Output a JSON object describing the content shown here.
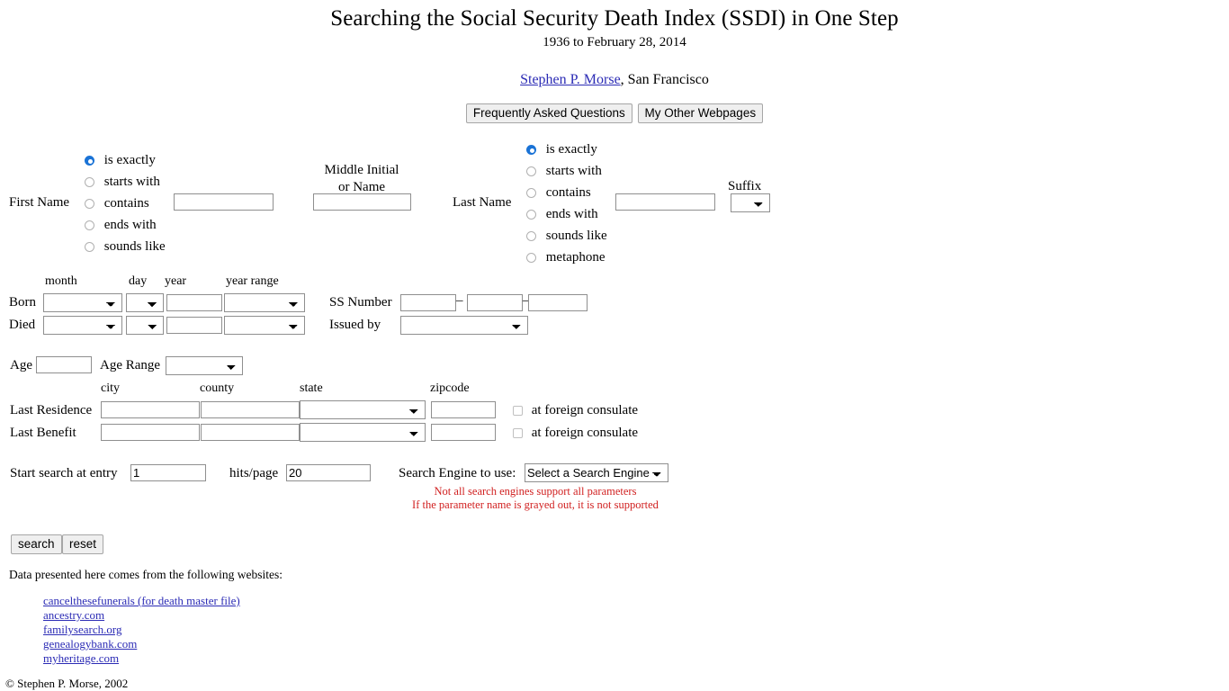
{
  "header": {
    "title": "Searching the Social Security Death Index (SSDI) in One Step",
    "subtitle": "1936 to February 28, 2014",
    "author_link": "Stephen P. Morse",
    "author_suffix": ", San Francisco",
    "faq_button": "Frequently Asked Questions",
    "webpages_button": "My Other Webpages"
  },
  "first_name": {
    "label": "First Name",
    "options": [
      "is exactly",
      "starts with",
      "contains",
      "ends with",
      "sounds like"
    ],
    "selected": "is exactly",
    "value": ""
  },
  "middle_name": {
    "label_line1": "Middle Initial",
    "label_line2": "or Name",
    "value": ""
  },
  "last_name": {
    "label": "Last Name",
    "options": [
      "is exactly",
      "starts with",
      "contains",
      "ends with",
      "sounds like",
      "metaphone"
    ],
    "selected": "is exactly",
    "value": ""
  },
  "suffix": {
    "label": "Suffix",
    "selected": "",
    "options": [
      ""
    ]
  },
  "dates": {
    "col_month": "month",
    "col_day": "day",
    "col_year": "year",
    "col_year_range": "year range",
    "born_label": "Born",
    "died_label": "Died",
    "born": {
      "month": "",
      "day": "",
      "year": "",
      "year_range": ""
    },
    "died": {
      "month": "",
      "day": "",
      "year": "",
      "year_range": ""
    }
  },
  "ssn": {
    "label": "SS Number",
    "part1": "",
    "part2": "",
    "part3": "",
    "separator": "–",
    "issued_by_label": "Issued by",
    "issued_by_value": ""
  },
  "age": {
    "label": "Age",
    "value": "",
    "range_label": "Age Range",
    "range_value": ""
  },
  "residence": {
    "col_city": "city",
    "col_county": "county",
    "col_state": "state",
    "col_zipcode": "zipcode",
    "last_residence_label": "Last Residence",
    "last_benefit_label": "Last Benefit",
    "consulate_label": "at foreign consulate",
    "last_residence": {
      "city": "",
      "county": "",
      "state": "",
      "zipcode": "",
      "consulate": false
    },
    "last_benefit": {
      "city": "",
      "county": "",
      "state": "",
      "zipcode": "",
      "consulate": false
    }
  },
  "search_options": {
    "start_label": "Start search at entry",
    "start_value": "1",
    "hits_label": "hits/page",
    "hits_value": "20",
    "engine_label": "Search Engine to use:",
    "engine_value": "Select a Search Engine",
    "note_line1": "Not all search engines support all parameters",
    "note_line2": "If the parameter name is grayed out, it is not supported",
    "note_color": "#d12121"
  },
  "actions": {
    "search_button": "search",
    "reset_button": "reset"
  },
  "footer": {
    "sources_heading": "Data presented here comes from the following websites:",
    "links": [
      "cancelthesefunerals (for death master file)",
      "ancestry.com",
      "familysearch.org",
      "genealogybank.com",
      "myheritage.com"
    ],
    "copyright": "© Stephen P. Morse, 2002",
    "link_color": "#2b2bb5"
  }
}
